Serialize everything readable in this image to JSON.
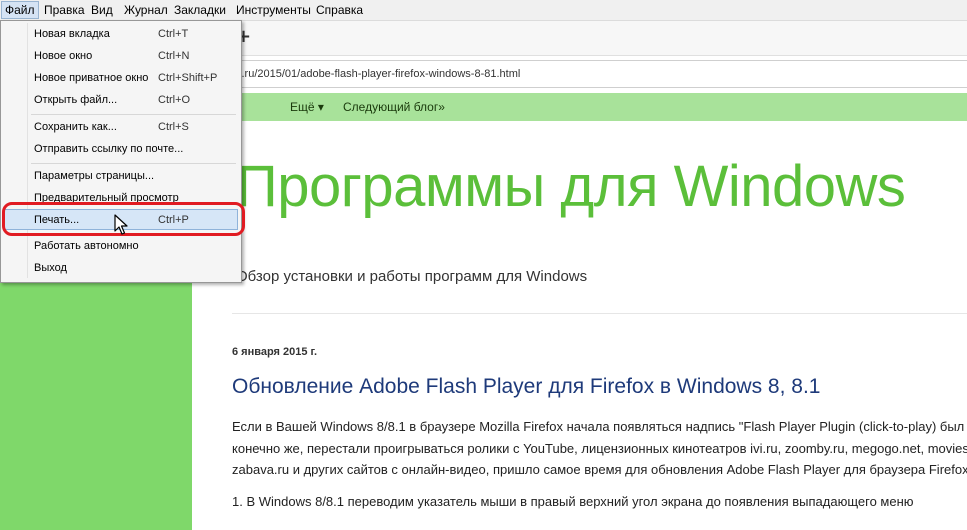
{
  "menubar": {
    "items": [
      {
        "label": "Файл",
        "active": true
      },
      {
        "label": "Правка",
        "active": false
      },
      {
        "label": "Вид",
        "active": false
      },
      {
        "label": "Журнал",
        "active": false
      },
      {
        "label": "Закладки",
        "active": false
      },
      {
        "label": "Инструменты",
        "active": false
      },
      {
        "label": "Справка",
        "active": false
      }
    ]
  },
  "toolbar": {
    "new_tab_glyph": "+"
  },
  "address": {
    "url": "s.ru/2015/01/adobe-flash-player-firefox-windows-8-81.html"
  },
  "blog_nav": {
    "more": "Ещё ▾",
    "next": "Следующий блог»"
  },
  "file_menu": {
    "items": [
      {
        "label": "Новая вкладка",
        "shortcut": "Ctrl+T"
      },
      {
        "label": "Новое окно",
        "shortcut": "Ctrl+N"
      },
      {
        "label": "Новое приватное окно",
        "shortcut": "Ctrl+Shift+P"
      },
      {
        "label": "Открыть файл...",
        "shortcut": "Ctrl+O"
      },
      {
        "label": "Сохранить как...",
        "shortcut": "Ctrl+S"
      },
      {
        "label": "Отправить ссылку по почте...",
        "shortcut": ""
      },
      {
        "label": "Параметры страницы...",
        "shortcut": ""
      },
      {
        "label": "Предварительный просмотр",
        "shortcut": ""
      },
      {
        "label": "Печать...",
        "shortcut": "Ctrl+P"
      },
      {
        "label": "Работать автономно",
        "shortcut": ""
      },
      {
        "label": "Выход",
        "shortcut": ""
      }
    ],
    "highlighted_item": "Печать..."
  },
  "page": {
    "blog_title": "Программы для Windows",
    "blog_subtitle": "Обзор установки и работы программ для Windows",
    "post_date": "6 января 2015 г.",
    "post_title": "Обновление Adobe Flash Player для Firefox в Windows 8, 8.1",
    "paragraph_lines": [
      "Если в Вашей Windows 8/8.1 в браузере Mozilla Firefox начала появляться надпись \"Flash Player Plugin (click-to-play) был",
      "конечно же, перестали проигрываться ролики с YouTube, лицензионных кинотеатров ivi.ru, zoomby.ru, megogo.net, movies.o",
      "zabava.ru и других сайтов с онлайн-видео, пришло самое время для обновления Adobe Flash Player для браузера Firefox.",
      "1. В Windows 8/8.1 переводим  указатель мыши в правый верхний угол экрана до появления выпадающего меню"
    ]
  },
  "colors": {
    "left_panel": "#7fd86a",
    "nav_bar": "#a8e29a",
    "blog_title": "#5bbf3a",
    "post_title": "#1e3a7a",
    "highlight_ring": "#e11b22"
  }
}
